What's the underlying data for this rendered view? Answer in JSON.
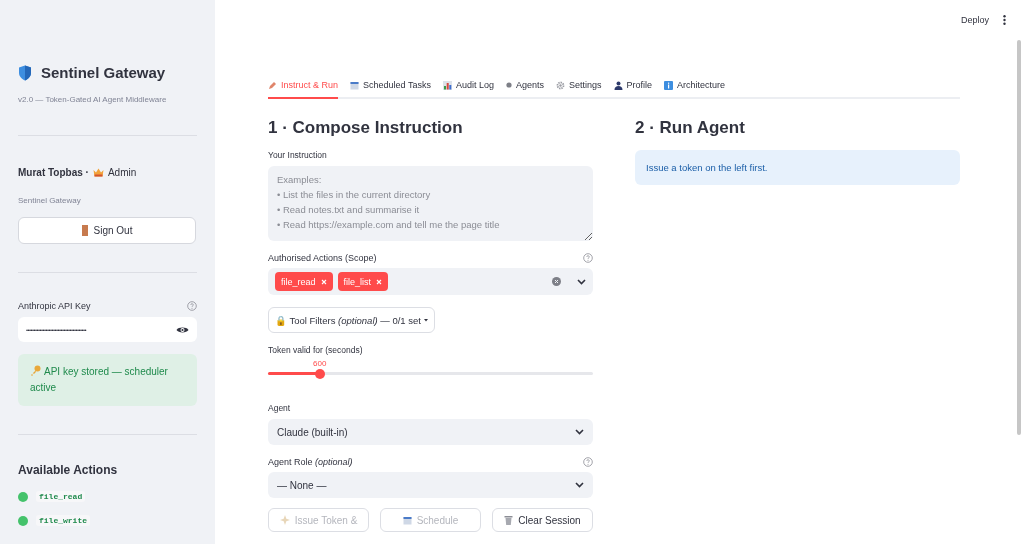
{
  "sidebar": {
    "title": "Sentinel Gateway",
    "subtitle": "v2.0 — Token-Gated AI Agent Middleware",
    "user": {
      "name": "Murat Topbas ·",
      "role": "Admin"
    },
    "org": "Sentinel Gateway",
    "sign_out": "Sign Out",
    "api_key": {
      "label": "Anthropic API Key",
      "value": "••••••••••••••••••••••••••••••••••••••••"
    },
    "api_status": "API key stored — scheduler active",
    "actions_title": "Available Actions",
    "actions": [
      {
        "name": "file_read"
      },
      {
        "name": "file_write"
      }
    ]
  },
  "header": {
    "deploy": "Deploy"
  },
  "tabs": [
    {
      "label": "Instruct & Run",
      "kind": "pencil",
      "selected": true
    },
    {
      "label": "Scheduled Tasks",
      "kind": "calendar",
      "selected": false
    },
    {
      "label": "Audit Log",
      "kind": "chart",
      "selected": false
    },
    {
      "label": "Agents",
      "kind": "dot",
      "selected": false
    },
    {
      "label": "Settings",
      "kind": "gear",
      "selected": false
    },
    {
      "label": "Profile",
      "kind": "person",
      "selected": false
    },
    {
      "label": "Architecture",
      "kind": "info",
      "selected": false
    }
  ],
  "compose": {
    "heading": "1 · Compose Instruction",
    "instruction": {
      "label": "Your Instruction",
      "placeholder": "Examples:\n• List the files in the current directory\n• Read notes.txt and summarise it\n• Read https://example.com and tell me the page title"
    },
    "scope": {
      "label": "Authorised Actions (Scope)",
      "chips": [
        "file_read",
        "file_list"
      ]
    },
    "tool_filters": "🔒 Tool Filters *(optional)* — 0/1 set",
    "token": {
      "label": "Token valid for (seconds)",
      "reading": "600",
      "level": 0.16
    },
    "agent": {
      "label": "Agent",
      "value": "Claude (built-in)"
    },
    "role": {
      "label": "Agent Role *(optional)*",
      "value": "— None —"
    },
    "buttons": [
      {
        "label": "Issue Token &",
        "kind": "sparkle",
        "disabled": true
      },
      {
        "label": "Schedule",
        "kind": "calendar",
        "disabled": true
      },
      {
        "label": "Clear Session",
        "kind": "trash",
        "disabled": false
      }
    ]
  },
  "run": {
    "heading": "2 · Run Agent",
    "notice": "Issue a token on the left first."
  }
}
